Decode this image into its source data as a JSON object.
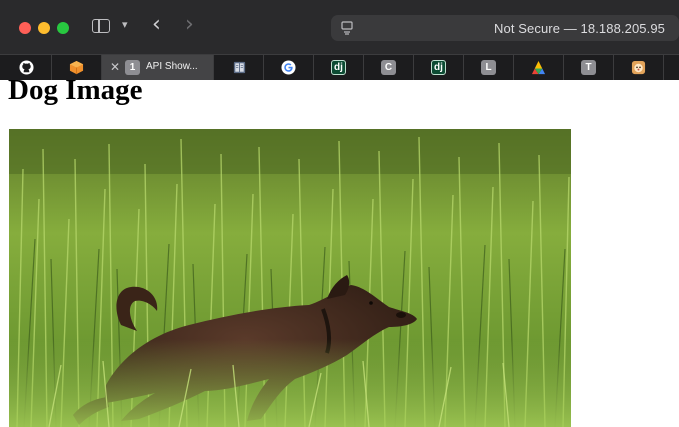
{
  "window": {
    "url": "Not Secure — 18.188.205.95",
    "colors": {
      "close": "#fe5f57",
      "minimize": "#febc2e",
      "zoom": "#28c840",
      "chrome": "#2a2a2c",
      "tabbar": "#1c1c1e"
    }
  },
  "tabs": [
    {
      "icon": "github-icon"
    },
    {
      "icon": "package-icon"
    },
    {
      "icon": "tab-number-icon",
      "badge": "1",
      "title": "API Show...",
      "active": true
    },
    {
      "icon": "book-icon"
    },
    {
      "icon": "google-icon"
    },
    {
      "icon": "django-icon",
      "badge": "dj"
    },
    {
      "icon": "letter-icon",
      "badge": "C"
    },
    {
      "icon": "django-icon",
      "badge": "dj"
    },
    {
      "icon": "letter-icon",
      "badge": "L"
    },
    {
      "icon": "colorful-logo-icon"
    },
    {
      "icon": "letter-icon",
      "badge": "T"
    },
    {
      "icon": "app-icon"
    }
  ],
  "page": {
    "heading": "Dog Image",
    "image_alt": "A dark brown dog leaping through tall green grass"
  }
}
